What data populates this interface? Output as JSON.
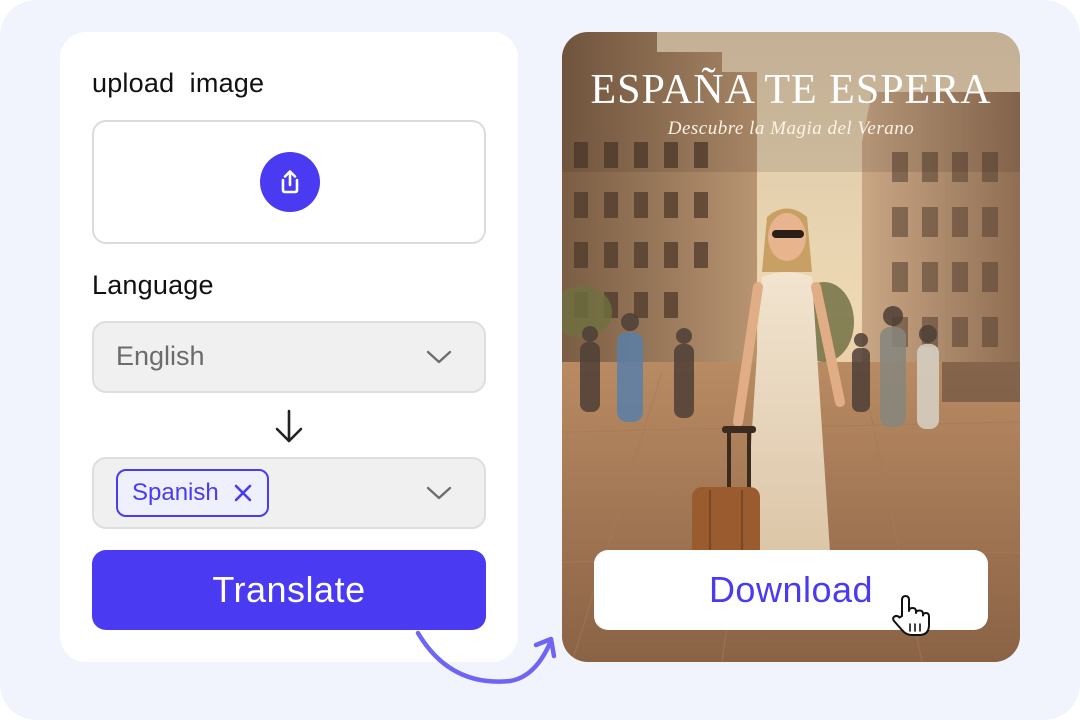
{
  "upload": {
    "label": "upload  image",
    "icon": "upload-icon"
  },
  "language": {
    "label": "Language",
    "source": {
      "value": "English"
    },
    "target": {
      "chip": "Spanish"
    }
  },
  "translate_label": "Translate",
  "poster": {
    "title": "ESPAÑA TE ESPERA",
    "subtitle": "Descubre la Magia del Verano"
  },
  "download_label": "Download",
  "colors": {
    "accent": "#4a3af2",
    "background": "#f1f4fd",
    "panel": "#ffffff"
  }
}
